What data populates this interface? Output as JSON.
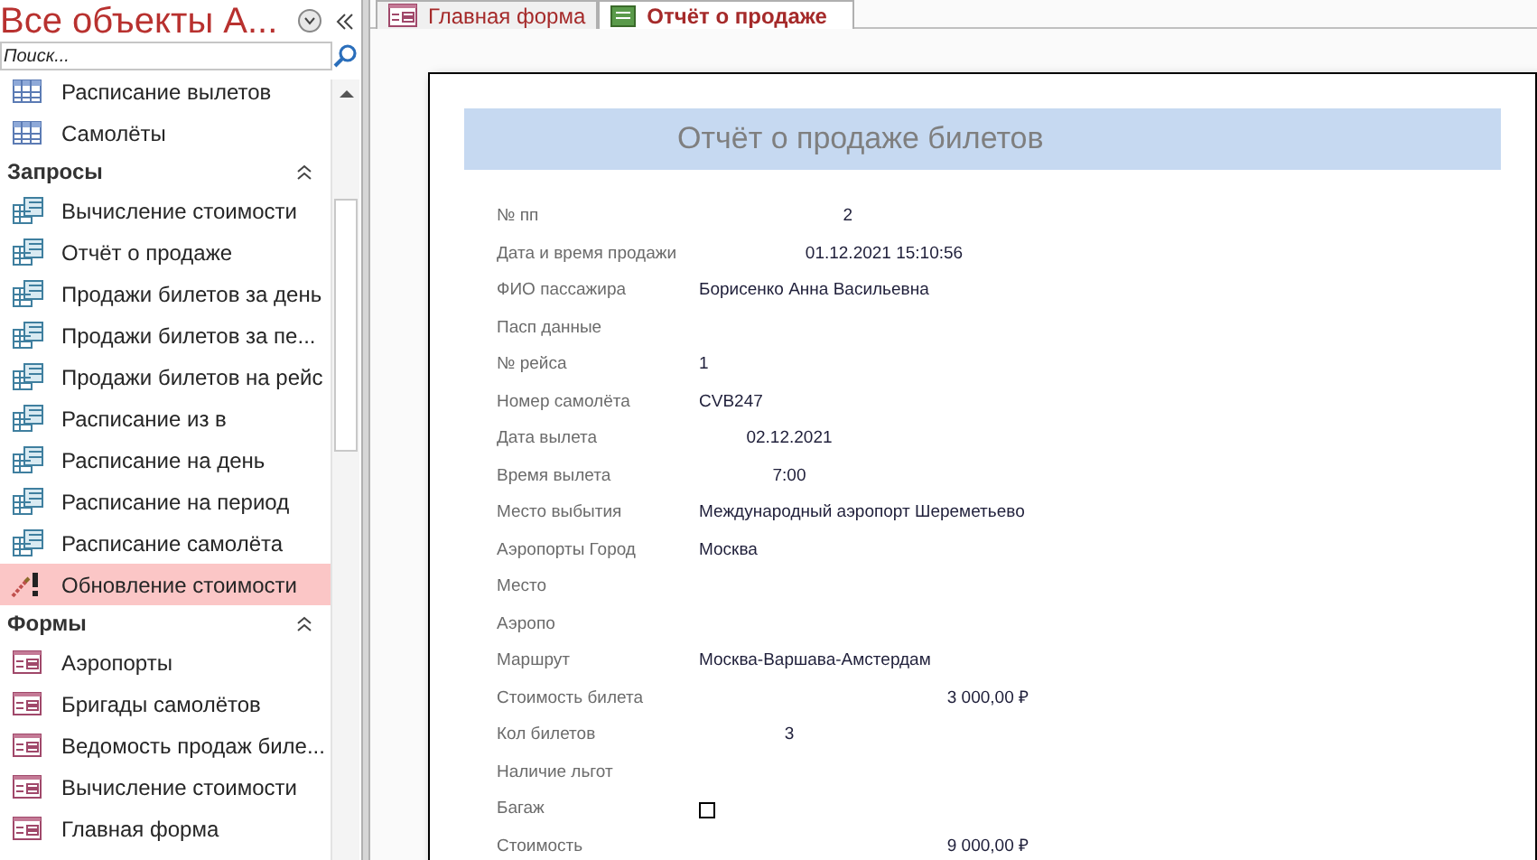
{
  "nav_pane": {
    "title": "Все объекты A...",
    "search": {
      "placeholder": "Поиск..."
    },
    "groups": [
      {
        "items": [
          {
            "label": "Расписание вылетов",
            "kind": "table",
            "selected": false
          },
          {
            "label": "Самолёты",
            "kind": "table",
            "selected": false
          }
        ]
      },
      {
        "title": "Запросы",
        "items": [
          {
            "label": "Вычисление стоимости",
            "kind": "query",
            "selected": false
          },
          {
            "label": "Отчёт о продаже",
            "kind": "query",
            "selected": false
          },
          {
            "label": "Продажи билетов за день",
            "kind": "query",
            "selected": false
          },
          {
            "label": "Продажи билетов за пе...",
            "kind": "query",
            "selected": false
          },
          {
            "label": "Продажи билетов на рейс",
            "kind": "query",
            "selected": false
          },
          {
            "label": "Расписание из в",
            "kind": "query",
            "selected": false
          },
          {
            "label": "Расписание на день",
            "kind": "query",
            "selected": false
          },
          {
            "label": "Расписание на период",
            "kind": "query",
            "selected": false
          },
          {
            "label": "Расписание самолёта",
            "kind": "query",
            "selected": false
          },
          {
            "label": "Обновление стоимости",
            "kind": "update",
            "selected": true
          }
        ]
      },
      {
        "title": "Формы",
        "items": [
          {
            "label": "Аэропорты",
            "kind": "form",
            "selected": false
          },
          {
            "label": "Бригады самолётов",
            "kind": "form",
            "selected": false
          },
          {
            "label": "Ведомость продаж биле...",
            "kind": "form",
            "selected": false
          },
          {
            "label": "Вычисление стоимости",
            "kind": "form",
            "selected": false
          },
          {
            "label": "Главная форма",
            "kind": "form",
            "selected": false
          }
        ]
      }
    ]
  },
  "tabs": [
    {
      "label": "Главная форма",
      "kind": "form",
      "selected": false
    },
    {
      "label": "Отчёт о продаже",
      "kind": "report",
      "selected": true
    }
  ],
  "report": {
    "title": "Отчёт о продаже билетов",
    "fields": [
      {
        "label": "№ пп",
        "kind": "short",
        "value": "2"
      },
      {
        "label": "Дата и время продажи",
        "kind": "datetime",
        "value": "01.12.2021 15:10:56"
      },
      {
        "label": "ФИО пассажира",
        "kind": "text",
        "value": "Борисенко Анна Васильевна"
      },
      {
        "label": "Пасп данные",
        "kind": "text"
      },
      {
        "label": "№ рейса",
        "kind": "text",
        "value": "1"
      },
      {
        "label": "Номер самолёта",
        "kind": "text",
        "value": "CVB247"
      },
      {
        "label": "Дата вылета",
        "kind": "center",
        "value": "02.12.2021"
      },
      {
        "label": "Время вылета",
        "kind": "center",
        "value": "7:00"
      },
      {
        "label": "Место выбытия",
        "kind": "text",
        "value": "Международный аэропорт Шереметьево"
      },
      {
        "label": "Аэропорты Город",
        "kind": "text",
        "value": "Москва"
      },
      {
        "label": "Место",
        "kind": "text"
      },
      {
        "label": "Аэропо",
        "kind": "text"
      },
      {
        "label": "Маршрут",
        "kind": "text",
        "value": "Москва-Варшава-Амстердам"
      },
      {
        "label": "Стоимость билета",
        "kind": "currency",
        "value": "3 000,00 ₽"
      },
      {
        "label": "Кол билетов",
        "kind": "center",
        "value": "3"
      },
      {
        "label": "Наличие льгот",
        "kind": "text"
      },
      {
        "label": "Багаж",
        "kind": "checkbox",
        "checked": false
      },
      {
        "label": "Стоимость",
        "kind": "currency",
        "value": "9 000,00 ₽"
      }
    ]
  }
}
